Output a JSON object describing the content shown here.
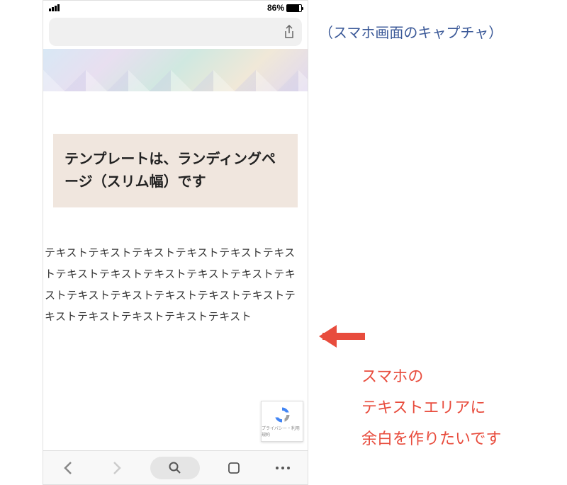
{
  "status": {
    "battery_pct": "86%"
  },
  "page": {
    "title_text": "テンプレートは、ランディングページ（スリム幅）です",
    "body_text": "テキストテキストテキストテキストテキストテキストテキストテキストテキストテキストテキストテキストテキストテキストテキストテキストテキストテキストテキストテキストテキストテキスト"
  },
  "recaptcha": {
    "label": "プライバシー・利用規約"
  },
  "annotations": {
    "caption": "（スマホ画面のキャプチャ）",
    "note_line1": "スマホの",
    "note_line2": "テキストエリアに",
    "note_line3": "余白を作りたいです"
  },
  "colors": {
    "annotation_blue": "#3b5998",
    "annotation_red": "#e84c3d",
    "title_bg": "#f0e6de"
  }
}
